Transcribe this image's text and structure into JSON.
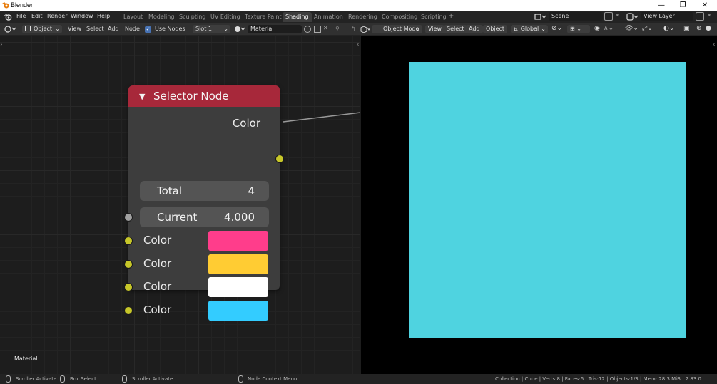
{
  "window": {
    "title": "Blender",
    "controls": {
      "minimize": "—",
      "maximize": "❐",
      "close": "✕"
    }
  },
  "menubar": {
    "menus": [
      "File",
      "Edit",
      "Render",
      "Window",
      "Help"
    ],
    "workspaces": [
      "Layout",
      "Modeling",
      "Sculpting",
      "UV Editing",
      "Texture Paint",
      "Shading",
      "Animation",
      "Rendering",
      "Compositing",
      "Scripting"
    ],
    "active_workspace": "Shading",
    "add_workspace": "+",
    "scene": "Scene",
    "view_layer": "View Layer"
  },
  "node_header": {
    "object_mode": "Object",
    "menus": [
      "View",
      "Select",
      "Add",
      "Node"
    ],
    "use_nodes_label": "Use Nodes",
    "use_nodes_checked": true,
    "slot": "Slot 1",
    "material": "Material"
  },
  "viewport_header": {
    "mode": "Object Mode",
    "menus": [
      "View",
      "Select",
      "Add",
      "Object"
    ],
    "orientation": "Global"
  },
  "node_editor": {
    "context_label": "Material",
    "node": {
      "title": "Selector Node",
      "output_label": "Color",
      "total": {
        "label": "Total",
        "value": "4"
      },
      "current": {
        "label": "Current",
        "value": "4.000"
      },
      "inputs": [
        {
          "label": "Color",
          "color": "#ff3d8b"
        },
        {
          "label": "Color",
          "color": "#ffcc33"
        },
        {
          "label": "Color",
          "color": "#ffffff"
        },
        {
          "label": "Color",
          "color": "#33ccff"
        }
      ]
    }
  },
  "viewport": {
    "background": "#000000",
    "plane_color": "#4fd3e0"
  },
  "statusbar": {
    "hints": [
      "Scroller Activate",
      "Box Select",
      "Scroller Activate",
      "Node Context Menu"
    ],
    "stats": "Collection | Cube | Verts:8 | Faces:6 | Tris:12 | Objects:1/3 | Mem: 28.3 MiB | 2.83.0"
  },
  "colors": {
    "node_header": "#a7283a",
    "socket_color": "#c7c729",
    "socket_float": "#a1a1a1",
    "accent": "#4772b3"
  }
}
